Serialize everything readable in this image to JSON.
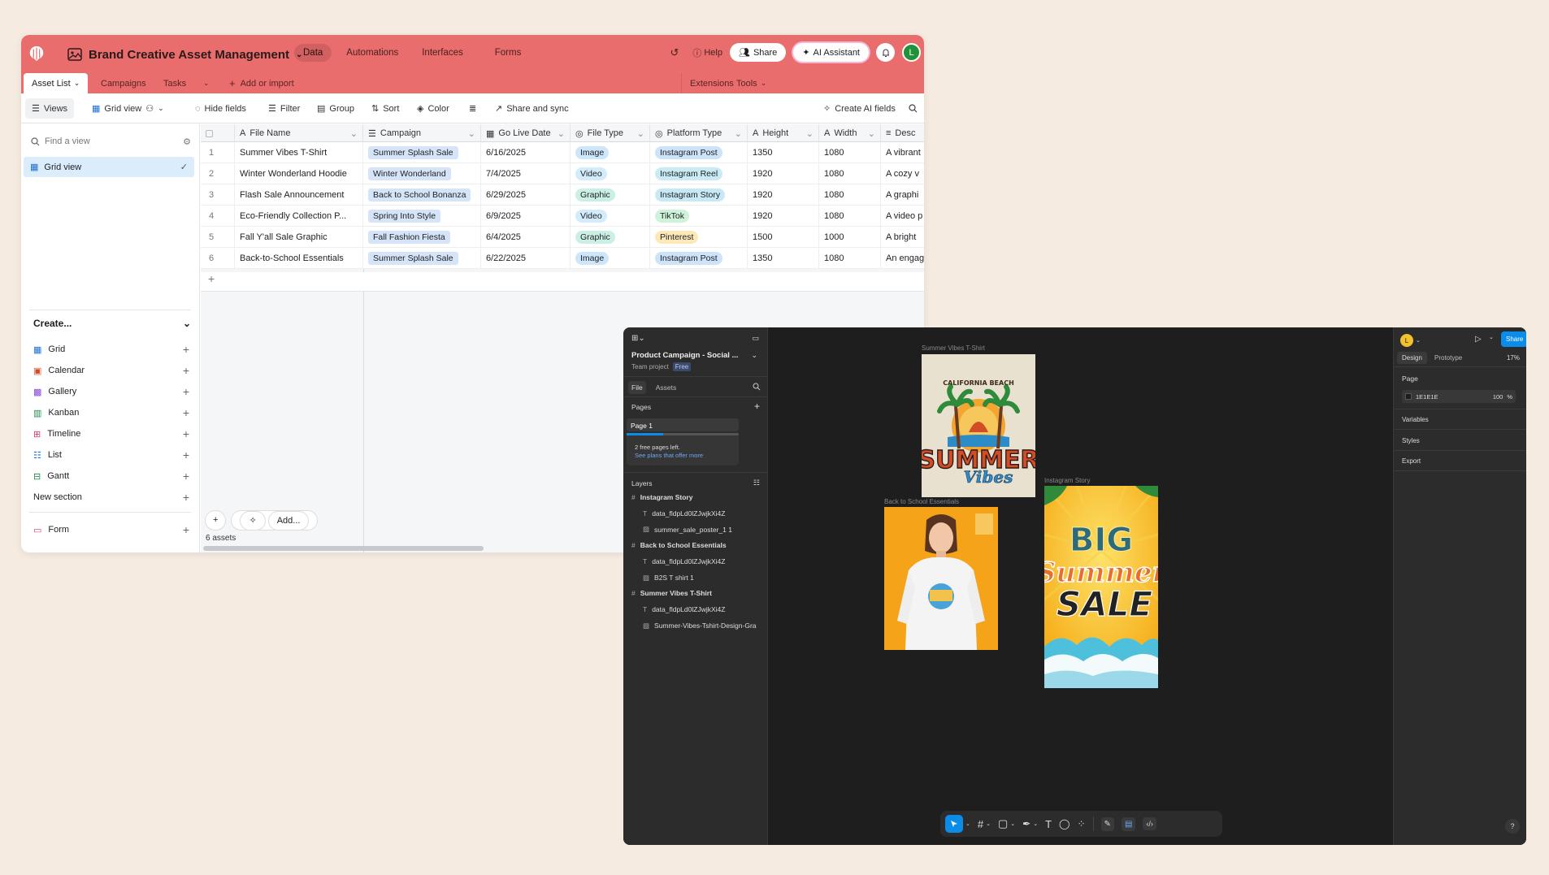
{
  "airtable": {
    "base_title": "Brand Creative Asset Management",
    "nav_tabs": [
      "Data",
      "Automations",
      "Interfaces",
      "Forms"
    ],
    "help": "Help",
    "share": "Share",
    "ai_assistant": "AI Assistant",
    "avatar": "L",
    "tables": [
      "Asset List",
      "Campaigns",
      "Tasks"
    ],
    "add_import": "Add or import",
    "extensions": "Extensions",
    "tools": "Tools",
    "toolbar": {
      "views": "Views",
      "grid_view": "Grid view",
      "hide_fields": "Hide fields",
      "filter": "Filter",
      "group": "Group",
      "sort": "Sort",
      "color": "Color",
      "share_sync": "Share and sync",
      "create_ai": "Create AI fields"
    },
    "sidebar": {
      "find_placeholder": "Find a view",
      "grid_view": "Grid view",
      "create": "Create...",
      "items": [
        "Grid",
        "Calendar",
        "Gallery",
        "Kanban",
        "Timeline",
        "List",
        "Gantt"
      ],
      "new_section": "New section",
      "form": "Form"
    },
    "columns": [
      "File Name",
      "Campaign",
      "Go Live Date",
      "File Type",
      "Platform Type",
      "Height",
      "Width",
      "Desc"
    ],
    "rows": [
      {
        "n": "1",
        "name": "Summer Vibes T-Shirt",
        "campaign": "Summer Splash Sale",
        "date": "6/16/2025",
        "type": "Image",
        "platform": "Instagram Post",
        "h": "1350",
        "w": "1080",
        "desc": "A vibrant"
      },
      {
        "n": "2",
        "name": "Winter Wonderland Hoodie",
        "campaign": "Winter Wonderland",
        "date": "7/4/2025",
        "type": "Video",
        "platform": "Instagram Reel",
        "h": "1920",
        "w": "1080",
        "desc": "A cozy v"
      },
      {
        "n": "3",
        "name": "Flash Sale Announcement",
        "campaign": "Back to School Bonanza",
        "date": "6/29/2025",
        "type": "Graphic",
        "platform": "Instagram Story",
        "h": "1920",
        "w": "1080",
        "desc": "A graphi"
      },
      {
        "n": "4",
        "name": "Eco-Friendly Collection P...",
        "campaign": "Spring Into Style",
        "date": "6/9/2025",
        "type": "Video",
        "platform": "TikTok",
        "h": "1920",
        "w": "1080",
        "desc": "A video p"
      },
      {
        "n": "5",
        "name": "Fall Y'all Sale Graphic",
        "campaign": "Fall Fashion Fiesta",
        "date": "6/4/2025",
        "type": "Graphic",
        "platform": "Pinterest",
        "h": "1500",
        "w": "1000",
        "desc": "A bright"
      },
      {
        "n": "6",
        "name": "Back-to-School Essentials",
        "campaign": "Summer Splash Sale",
        "date": "6/22/2025",
        "type": "Image",
        "platform": "Instagram Post",
        "h": "1350",
        "w": "1080",
        "desc": "An engag"
      }
    ],
    "add_button": "Add...",
    "count": "6 assets"
  },
  "figma": {
    "file_title": "Product Campaign - Social ...",
    "team": "Team project",
    "free": "Free",
    "tabs": [
      "File",
      "Assets"
    ],
    "pages": "Pages",
    "page1": "Page 1",
    "free_left": "2 free pages left.",
    "see_plans": "See plans that offer more",
    "layers": "Layers",
    "layer_items": [
      {
        "name": "Instagram Story",
        "kind": "frame"
      },
      {
        "name": "data_fldpLd0lZJwjkXi4Z",
        "kind": "text"
      },
      {
        "name": "summer_sale_poster_1 1",
        "kind": "image"
      },
      {
        "name": "Back to School Essentials",
        "kind": "frame"
      },
      {
        "name": "data_fldpLd0lZJwjkXi4Z",
        "kind": "text"
      },
      {
        "name": "B2S T shirt 1",
        "kind": "image"
      },
      {
        "name": "Summer Vibes T-Shirt",
        "kind": "frame"
      },
      {
        "name": "data_fldpLd0lZJwjkXi4Z",
        "kind": "text"
      },
      {
        "name": "Summer-Vibes-Tshirt-Design-Gra",
        "kind": "image"
      }
    ],
    "frames": {
      "f1": "Summer Vibes T-Shirt",
      "f2": "Back to School Essentials",
      "f3": "Instagram Story"
    },
    "art": {
      "beach": "CALIFORNIA BEACH",
      "summer": "SUMMER",
      "vibes": "Vibes",
      "big": "BIG",
      "summer2": "Summer",
      "sale": "SALE"
    },
    "right": {
      "avatar": "L",
      "design": "Design",
      "prototype": "Prototype",
      "zoom": "17%",
      "page": "Page",
      "color": "1E1E1E",
      "opacity": "100",
      "pct": "%",
      "variables": "Variables",
      "styles": "Styles",
      "export": "Export",
      "share": "Share",
      "help": "?"
    }
  },
  "colors": {
    "airtable_header": "#e96d6c",
    "figma_bg": "#1e1e1e",
    "figma_accent": "#0c8ce9"
  }
}
